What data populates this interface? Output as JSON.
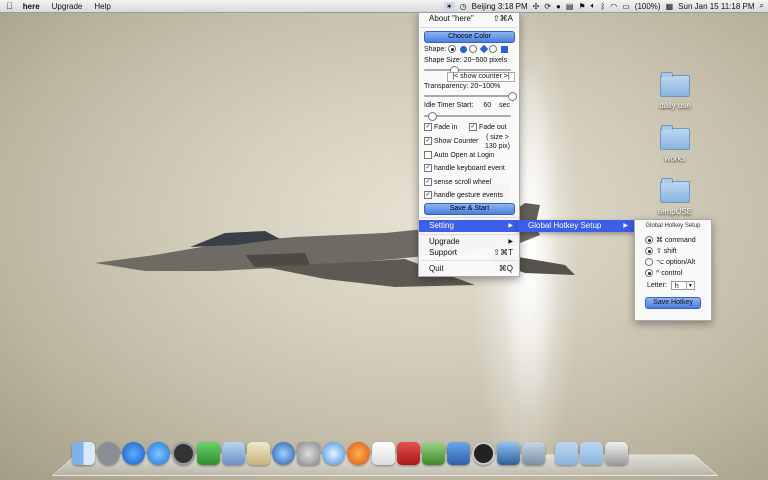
{
  "menubar": {
    "app": "here",
    "menus": [
      "Upgrade",
      "Help"
    ],
    "status_right": {
      "clock_city": "Beijing 3:18 PM",
      "battery": "(100%)",
      "datetime": "Sun Jan 15  11:18 PM"
    }
  },
  "menu": {
    "about": "About \"here\"",
    "about_shortcut": "⇧⌘A",
    "choose_color": "Choose Color",
    "shape_label": "Shape:",
    "shape_size": "Shape Size: 20~500 pixels",
    "show_counter": "|< show counter >|",
    "transparency": "Transparency: 20~100%",
    "idle_timer_label": "Idle Timer Start:",
    "idle_timer_value": "60",
    "idle_timer_unit": "sec",
    "fade_in": "Fade in",
    "fade_out": "Fade out",
    "show_counter_chk": "Show Counter",
    "size_note_1": "( size >",
    "size_note_2": "130 pix)",
    "auto_open": "Auto Open at Login",
    "handle_keyboard": "handle keyboard event",
    "sense_scroll": "sense scroll wheel",
    "handle_gesture": "handle gesture events",
    "save_start": "Save & Start",
    "setting": "Setting",
    "upgrade": "Upgrade",
    "support": "Support",
    "support_shortcut": "⇧⌘T",
    "quit": "Quit",
    "quit_shortcut": "⌘Q"
  },
  "submenu": {
    "global_hotkey": "Global Hotkey Setup"
  },
  "hotkey_panel": {
    "title": "Global Hotkey Setup",
    "command": "⌘ command",
    "shift": "⇧ shift",
    "option": "⌥ option/Alt",
    "control": "^ control",
    "letter_label": "Letter:",
    "letter_value": "h",
    "save": "Save Hotkey"
  },
  "desktop_folders": [
    "daily use",
    "works",
    "tempUSE"
  ],
  "colors": {
    "highlight": "#3d5ee8",
    "button": "#4a7fe0"
  }
}
